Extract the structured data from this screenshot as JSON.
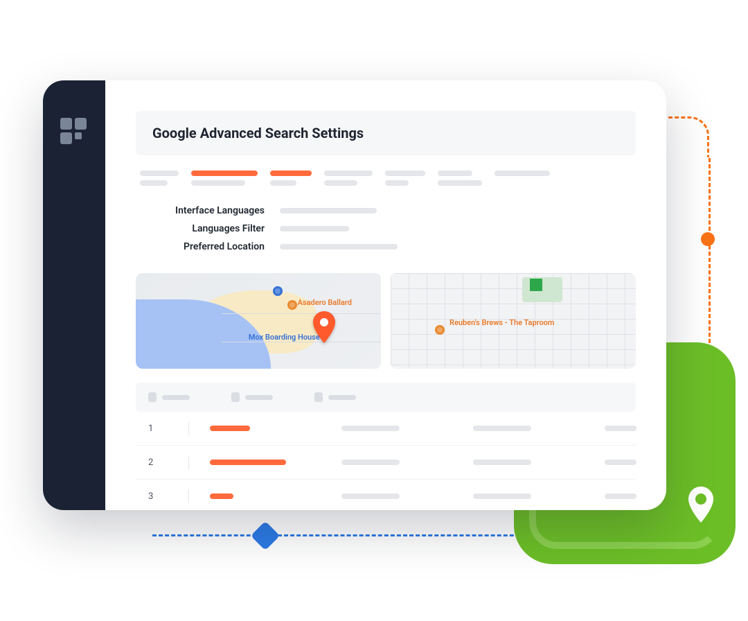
{
  "page_title": "Google Advanced Search Settings",
  "settings": {
    "interface_languages_label": "Interface Languages",
    "languages_filter_label": "Languages Filter",
    "preferred_location_label": "Preferred Location"
  },
  "map": {
    "poi1": "Asadero Ballard",
    "poi2": "Mox Boarding House",
    "poi3": "Reuben's Brews - The Taproom"
  },
  "table": {
    "rows": [
      {
        "index": "1"
      },
      {
        "index": "2"
      },
      {
        "index": "3"
      }
    ]
  },
  "colors": {
    "accent_orange": "#FF6A3D",
    "sidebar": "#1A2233",
    "green": "#6CBE27",
    "blue": "#2C7BE5"
  }
}
